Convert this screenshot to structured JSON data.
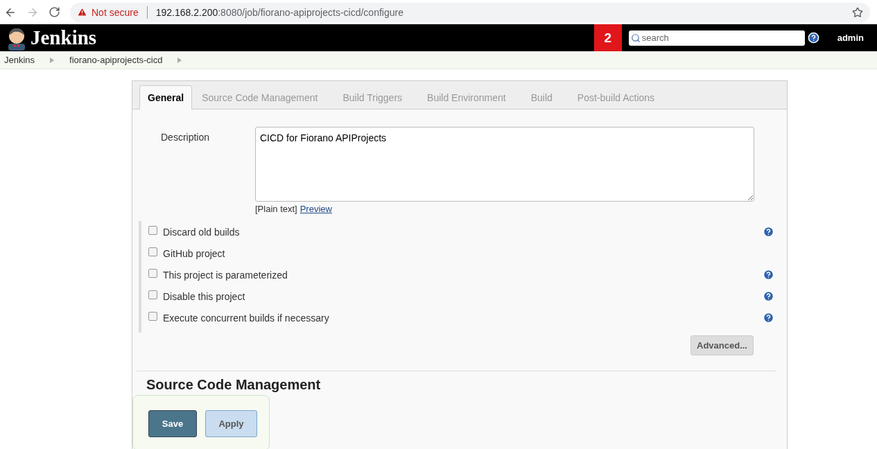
{
  "browser": {
    "security": "Not secure",
    "url_host": "192.168.2.200",
    "url_path": ":8080/job/fiorano-apiprojects-cicd/configure"
  },
  "header": {
    "logo": "Jenkins",
    "notifications": "2",
    "search": {
      "placeholder": "search"
    },
    "user": "admin"
  },
  "breadcrumbs": [
    "Jenkins",
    "fiorano-apiprojects-cicd"
  ],
  "tabs": [
    {
      "label": "General",
      "selected": true
    },
    {
      "label": "Source Code Management",
      "selected": false
    },
    {
      "label": "Build Triggers",
      "selected": false
    },
    {
      "label": "Build Environment",
      "selected": false
    },
    {
      "label": "Build",
      "selected": false
    },
    {
      "label": "Post-build Actions",
      "selected": false
    }
  ],
  "description": {
    "label": "Description",
    "value": "CICD for Fiorano APIProjects",
    "format": "[Plain text]",
    "preview": "Preview"
  },
  "options": [
    {
      "label": "Discard old builds",
      "checked": false,
      "help": true
    },
    {
      "label": "GitHub project",
      "checked": false,
      "help": false
    },
    {
      "label": "This project is parameterized",
      "checked": false,
      "help": true
    },
    {
      "label": "Disable this project",
      "checked": false,
      "help": true
    },
    {
      "label": "Execute concurrent builds if necessary",
      "checked": false,
      "help": true
    }
  ],
  "advanced_button": "Advanced...",
  "section_heading": "Source Code Management",
  "buttons": [
    "Save",
    "Apply"
  ]
}
